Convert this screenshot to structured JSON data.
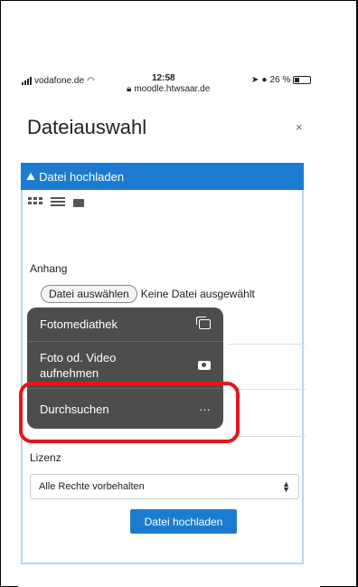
{
  "status_bar": {
    "carrier": "vodafone.de",
    "time": "12:58",
    "url": "moodle.htwsaar.de",
    "battery": "26 %"
  },
  "modal": {
    "title": "Dateiauswahl",
    "close": "×",
    "upload_header": "Datei hochladen"
  },
  "form": {
    "attachment_label": "Anhang",
    "choose_file_button": "Datei auswählen",
    "no_file_text": "Keine Datei ausgewählt",
    "license_label": "Lizenz",
    "license_value": "Alle Rechte vorbehalten",
    "submit_button": "Datei hochladen"
  },
  "file_picker_menu": {
    "items": [
      {
        "label": "Fotomediathek",
        "icon": "photo-library-icon"
      },
      {
        "label": "Foto od. Video aufnehmen",
        "icon": "camera-icon"
      },
      {
        "label": "Durchsuchen",
        "icon": "more-icon",
        "icon_glyph": "···"
      }
    ]
  },
  "colors": {
    "accent": "#1b7bd1",
    "menu_bg": "#4d4d4d",
    "highlight": "#e5141f"
  }
}
